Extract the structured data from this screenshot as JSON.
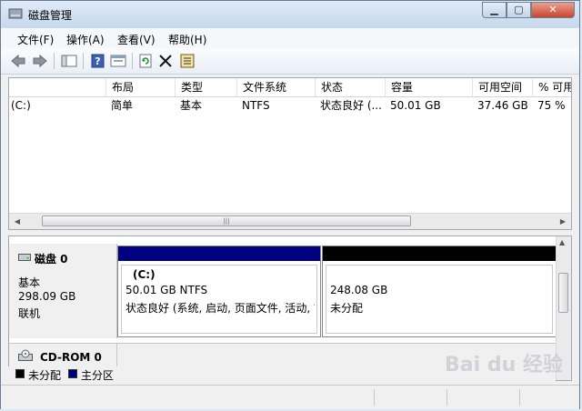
{
  "window": {
    "title": "磁盘管理"
  },
  "menu": [
    "文件(F)",
    "操作(A)",
    "查看(V)",
    "帮助(H)"
  ],
  "columns": [
    "",
    "布局",
    "类型",
    "文件系统",
    "状态",
    "容量",
    "可用空间",
    "% 可用"
  ],
  "volumes": [
    {
      "volume": "(C:)",
      "layout": "简单",
      "type": "基本",
      "fs": "NTFS",
      "status": "状态良好 (...",
      "capacity": "50.01 GB",
      "free": "37.46 GB",
      "pct": "75 %"
    }
  ],
  "disk0": {
    "name": "磁盘 0",
    "type": "基本",
    "size": "298.09 GB",
    "state": "联机",
    "partitions": [
      {
        "label": "(C:)",
        "size": "50.01 GB NTFS",
        "status": "状态良好 (系统, 启动, 页面文件, 活动, 故",
        "color": "#000080"
      },
      {
        "label": "",
        "size": "248.08 GB",
        "status": "未分配",
        "color": "#000000"
      }
    ]
  },
  "cdrom": {
    "name": "CD-ROM 0"
  },
  "legend": [
    {
      "label": "未分配",
      "color": "#000000"
    },
    {
      "label": "主分区",
      "color": "#000080"
    }
  ],
  "watermark": "Bai du 经验"
}
